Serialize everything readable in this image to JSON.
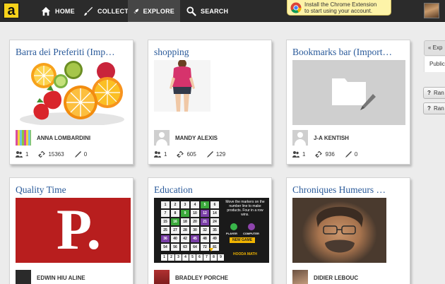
{
  "topbar": {
    "logo": "a",
    "nav": [
      {
        "label": "HOME",
        "icon": "home-icon"
      },
      {
        "label": "COLLECT",
        "icon": "brush-icon"
      },
      {
        "label": "EXPLORE",
        "icon": "rocket-icon",
        "active": true
      },
      {
        "label": "SEARCH",
        "icon": "search-icon"
      }
    ],
    "chrome_banner": {
      "line1": "Install the Chrome Extension",
      "line2": "to start using your account."
    }
  },
  "cards": [
    {
      "title": "Barra dei Preferiti (Imp…",
      "owner": "ANNA LOMBARDINI",
      "stats": {
        "followers": "1",
        "links": "15363",
        "comments": "0"
      }
    },
    {
      "title": "shopping",
      "owner": "MANDY ALEXIS",
      "stats": {
        "followers": "1",
        "links": "605",
        "comments": "129"
      }
    },
    {
      "title": "Bookmarks bar (Import…",
      "owner": "J-A KENTISH",
      "stats": {
        "followers": "1",
        "links": "936",
        "comments": "0"
      }
    },
    {
      "title": "Quality Time",
      "owner": "EDWIN HIU ALINE",
      "thumb_text": "P."
    },
    {
      "title": "Education",
      "owner": "BRADLEY PORCHE",
      "game_text": "Move the markers on the number line to make products. Four in a row wins.",
      "game_player_labels": [
        "PLAYER",
        "COMPUTER"
      ],
      "game_button": "NEW GAME",
      "game_brand": "HOODA MATH",
      "game_strip": [
        "1",
        "2",
        "3",
        "4",
        "5",
        "6",
        "7",
        "8",
        "9"
      ],
      "grid": [
        "1",
        "2",
        "3",
        "4",
        "5",
        "6",
        "7",
        "8",
        "9",
        "10",
        "12",
        "14",
        "15",
        "16",
        "18",
        "20",
        "21",
        "24",
        "25",
        "27",
        "28",
        "30",
        "32",
        "35",
        "36",
        "40",
        "42",
        "45",
        "48",
        "49",
        "54",
        "56",
        "63",
        "64",
        "72",
        "81"
      ]
    },
    {
      "title": "Chroniques Humeurs …",
      "owner": "DIDIER LEBOUC"
    }
  ],
  "side_panel": {
    "tab_label": "« Exp",
    "public_label": "Public",
    "buttons": [
      "Ran",
      "Ran"
    ]
  },
  "colors": {
    "topbar": "#2b2b2b",
    "title_link": "#2a5a9a",
    "logo": "#f6d21a"
  }
}
